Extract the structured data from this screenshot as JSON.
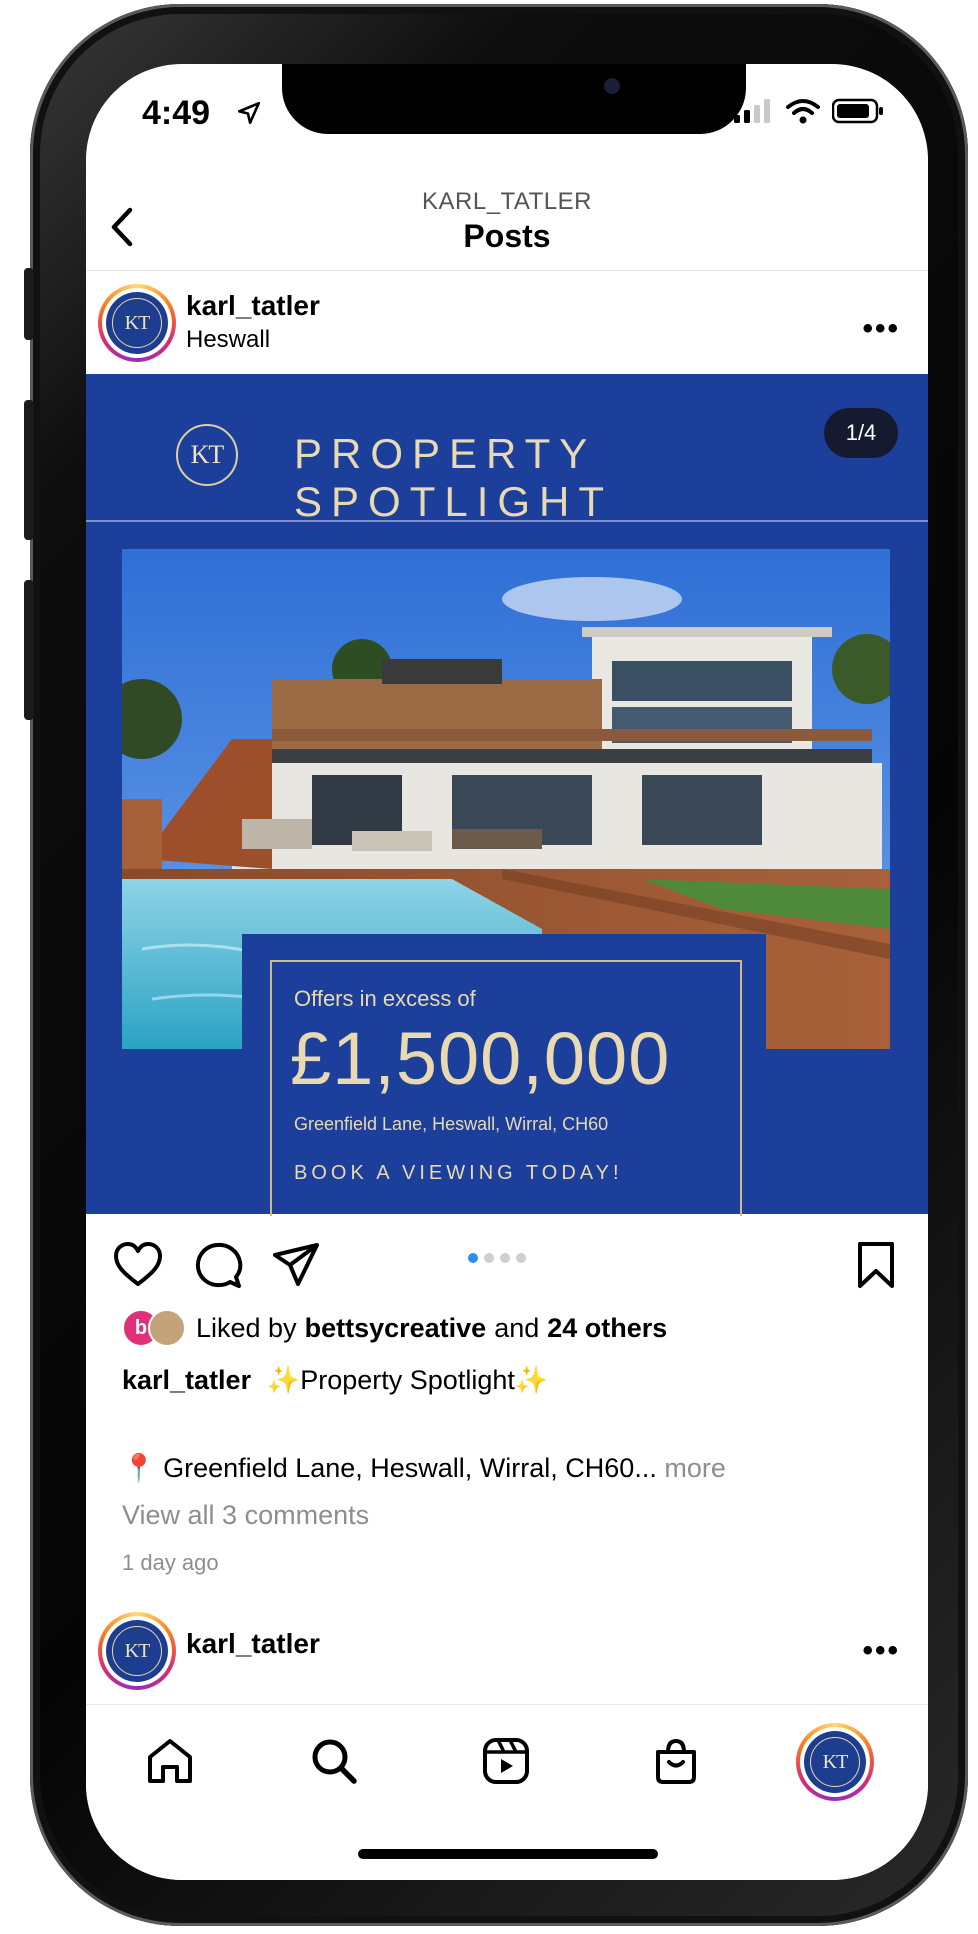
{
  "status_bar": {
    "time": "4:49"
  },
  "nav": {
    "subtitle": "KARL_TATLER",
    "title": "Posts"
  },
  "post": {
    "username": "karl_tatler",
    "location": "Heswall",
    "avatar_text": "KT",
    "image": {
      "logo_text": "KT",
      "banner_title": "PROPERTY SPOTLIGHT",
      "counter": "1/4",
      "offers_label": "Offers in excess of",
      "price": "£1,500,000",
      "address": "Greenfield Lane, Heswall, Wirral, CH60",
      "cta": "BOOK A VIEWING TODAY!"
    },
    "carousel": {
      "total": 4,
      "current": 1
    },
    "likes": {
      "prefix": "Liked by",
      "user": "bettsycreative",
      "joiner": "and",
      "others": "24 others",
      "avatar_letter": "b"
    },
    "caption": {
      "username": "karl_tatler",
      "text": "Property Spotlight"
    },
    "caption_location": {
      "text": "Greenfield Lane, Heswall, Wirral, CH60...",
      "more": "more"
    },
    "view_comments": "View all 3 comments",
    "time_ago": "1 day ago"
  },
  "next_post": {
    "username": "karl_tatler",
    "avatar_text": "KT"
  },
  "tabbar": {
    "items": [
      "home",
      "search",
      "reels",
      "shop",
      "profile"
    ],
    "profile_avatar_text": "KT"
  },
  "colors": {
    "brand_blue": "#1c3f9b",
    "gold": "#e8d9b0",
    "accent_dot": "#2d8df0"
  }
}
